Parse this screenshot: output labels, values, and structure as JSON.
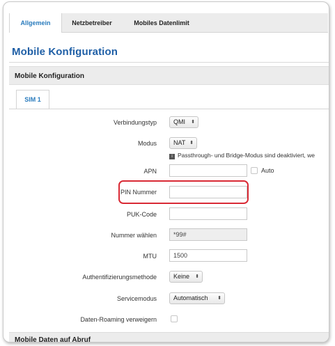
{
  "tabs": [
    {
      "label": "Allgemein",
      "active": true
    },
    {
      "label": "Netzbetreiber",
      "active": false
    },
    {
      "label": "Mobiles Datenlimit",
      "active": false
    }
  ],
  "page_title": "Mobile Konfiguration",
  "section_title": "Mobile Konfiguration",
  "sim_tab": "SIM 1",
  "form": {
    "verbindungstyp": {
      "label": "Verbindungstyp",
      "value": "QMI"
    },
    "modus": {
      "label": "Modus",
      "value": "NAT"
    },
    "hint": "Passthrough- und Bridge-Modus sind deaktiviert, we",
    "apn": {
      "label": "APN",
      "value": "",
      "auto_label": "Auto"
    },
    "pin": {
      "label": "PIN Nummer",
      "value": ""
    },
    "puk": {
      "label": "PUK-Code",
      "value": ""
    },
    "nummer": {
      "label": "Nummer wählen",
      "value": "*99#"
    },
    "mtu": {
      "label": "MTU",
      "value": "1500"
    },
    "auth": {
      "label": "Authentifizierungsmethode",
      "value": "Keine"
    },
    "servicemodus": {
      "label": "Servicemodus",
      "value": "Automatisch"
    },
    "roaming": {
      "label": "Daten-Roaming verweigern",
      "checked": false
    }
  },
  "bottom_section_title": "Mobile Daten auf Abruf",
  "colors": {
    "accent_blue": "#2a7cbd",
    "title_blue": "#1f5fa6",
    "highlight_red": "#d92a35"
  }
}
